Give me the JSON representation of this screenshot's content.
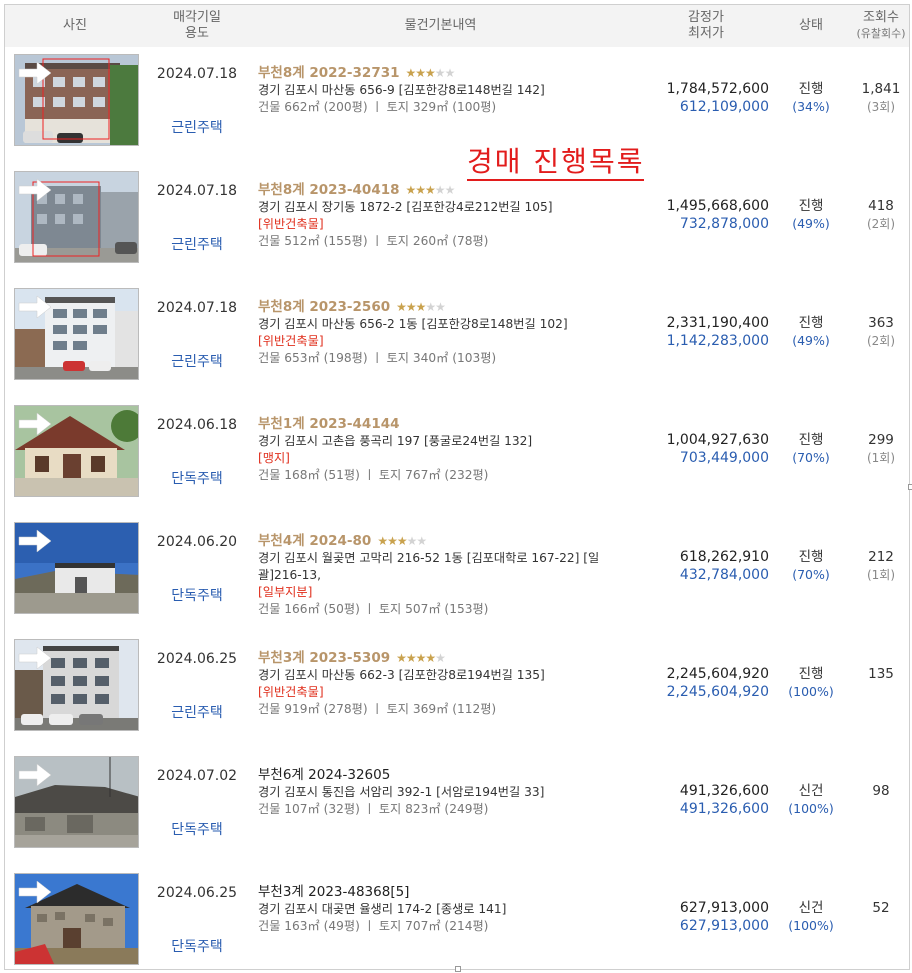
{
  "header": {
    "photo": "사진",
    "date_label": "매각기일",
    "use_label": "용도",
    "basic": "물건기본내역",
    "appraisal_label": "감정가",
    "minimum_label": "최저가",
    "status": "상태",
    "views_label": "조회수",
    "views_sub": "(유찰회수)"
  },
  "overlay_text": "경매  진행목록",
  "rows": [
    {
      "date": "2024.07.18",
      "use": "근린주택",
      "case": "부천8계 2022-32731",
      "stars": 3,
      "address": "경기 김포시 마산동 656-9 [김포한강8로148번길 142]",
      "warn": "",
      "area": "건물 662㎡ (200평)  ㅣ  토지 329㎡ (100평)",
      "appraisal": "1,784,572,600",
      "minimum": "612,109,000",
      "status": "진행",
      "pct": "(34%)",
      "views": "1,841",
      "fails": "(3회)",
      "photo": "brick-building"
    },
    {
      "date": "2024.07.18",
      "use": "근린주택",
      "case": "부천8계 2023-40418",
      "stars": 3,
      "address": "경기 김포시 장기동 1872-2 [김포한강4로212번길 105]",
      "warn": "[위반건축물]",
      "area": "건물 512㎡ (155평)  ㅣ  토지 260㎡ (78평)",
      "appraisal": "1,495,668,600",
      "minimum": "732,878,000",
      "status": "진행",
      "pct": "(49%)",
      "views": "418",
      "fails": "(2회)",
      "photo": "grey-building"
    },
    {
      "date": "2024.07.18",
      "use": "근린주택",
      "case": "부천8계 2023-2560",
      "stars": 3,
      "address": "경기 김포시 마산동 656-2 1동 [김포한강8로148번길 102]",
      "warn": "[위반건축물]",
      "area": "건물 653㎡ (198평)  ㅣ  토지 340㎡ (103평)",
      "appraisal": "2,331,190,400",
      "minimum": "1,142,283,000",
      "status": "진행",
      "pct": "(49%)",
      "views": "363",
      "fails": "(2회)",
      "photo": "white-building"
    },
    {
      "date": "2024.06.18",
      "use": "단독주택",
      "case": "부천1계 2023-44144",
      "stars": 0,
      "address": "경기 김포시 고촌읍 풍곡리 197 [풍굴로24번길 132]",
      "warn": "[맹지]",
      "area": "건물 168㎡ (51평)  ㅣ  토지 767㎡ (232평)",
      "appraisal": "1,004,927,630",
      "minimum": "703,449,000",
      "status": "진행",
      "pct": "(70%)",
      "views": "299",
      "fails": "(1회)",
      "photo": "red-house"
    },
    {
      "date": "2024.06.20",
      "use": "단독주택",
      "case": "부천4계 2024-80",
      "stars": 3,
      "address": "경기 김포시 월곶면 고막리 216-52 1동 [김포대학로 167-22]  [일괄]216-13,",
      "warn": "[일부지분]",
      "area": "건물 166㎡ (50평)  ㅣ  토지 507㎡ (153평)",
      "appraisal": "618,262,910",
      "minimum": "432,784,000",
      "status": "진행",
      "pct": "(70%)",
      "views": "212",
      "fails": "(1회)",
      "photo": "sky-house"
    },
    {
      "date": "2024.06.25",
      "use": "근린주택",
      "case": "부천3계 2023-5309",
      "stars": 4,
      "address": "경기 김포시 마산동 662-3 [김포한강8로194번길 135]",
      "warn": "[위반건축물]",
      "area": "건물 919㎡ (278평)  ㅣ  토지 369㎡ (112평)",
      "appraisal": "2,245,604,920",
      "minimum": "2,245,604,920",
      "status": "진행",
      "pct": "(100%)",
      "views": "135",
      "fails": "",
      "photo": "modern-building"
    },
    {
      "date": "2024.07.02",
      "use": "단독주택",
      "case": "부천6계 2024-32605",
      "stars": -1,
      "address": "경기 김포시 통진읍 서암리 392-1 [서암로194번길 33]",
      "warn": "",
      "area": "건물 107㎡ (32평)  ㅣ  토지 823㎡ (249평)",
      "appraisal": "491,326,600",
      "minimum": "491,326,600",
      "status": "신건",
      "pct": "(100%)",
      "views": "98",
      "fails": "",
      "photo": "old-house"
    },
    {
      "date": "2024.06.25",
      "use": "단독주택",
      "case": "부천3계 2023-48368[5]",
      "stars": -1,
      "address": "경기 김포시 대곶면 율생리 174-2 [종생로 141]",
      "warn": "",
      "area": "건물 163㎡ (49평)  ㅣ  토지 707㎡ (214평)",
      "appraisal": "627,913,000",
      "minimum": "627,913,000",
      "status": "신건",
      "pct": "(100%)",
      "views": "52",
      "fails": "",
      "photo": "stone-house"
    }
  ]
}
